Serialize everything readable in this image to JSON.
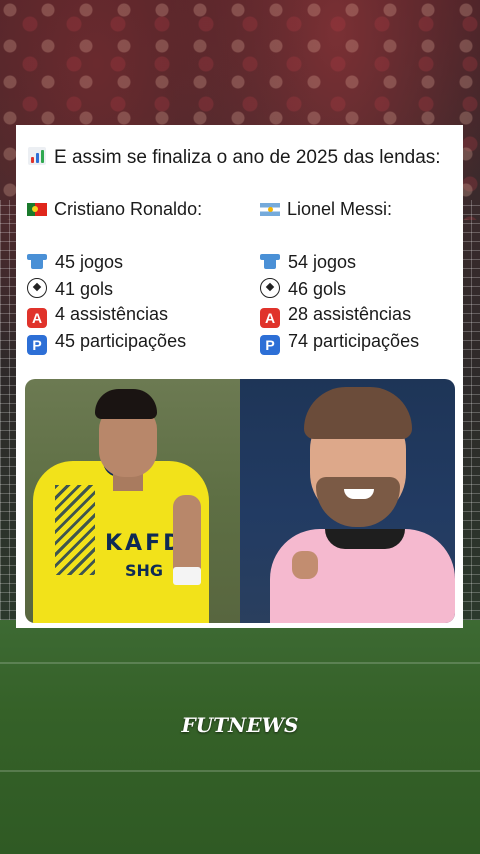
{
  "post": {
    "headline": "E assim se finaliza o ano de 2025 das lendas:",
    "players": [
      {
        "name": "Cristiano Ronaldo:",
        "flag": "portugal-flag",
        "stats": [
          {
            "icon": "shirt-icon",
            "text": "45 jogos"
          },
          {
            "icon": "soccer-ball-icon",
            "text": "41 gols"
          },
          {
            "icon": "a-button-icon",
            "text": "4 assistências"
          },
          {
            "icon": "p-button-icon",
            "text": "45 participações"
          }
        ]
      },
      {
        "name": "Lionel Messi:",
        "flag": "argentina-flag",
        "stats": [
          {
            "icon": "shirt-icon",
            "text": "54 jogos"
          },
          {
            "icon": "soccer-ball-icon",
            "text": "46 gols"
          },
          {
            "icon": "a-button-icon",
            "text": "28 assistências"
          },
          {
            "icon": "p-button-icon",
            "text": "74 participações"
          }
        ]
      }
    ],
    "photo_left": {
      "jersey_sponsor": "KAFD",
      "jersey_sponsor2": "SHG"
    },
    "photo_right": {}
  },
  "watermark": "FUTNEWS",
  "colors": {
    "card_bg": "#ffffff",
    "text": "#1a1a1a",
    "pitch": "#356128",
    "alnassr_yellow": "#f2e21a",
    "miami_pink": "#f5b9cf"
  }
}
